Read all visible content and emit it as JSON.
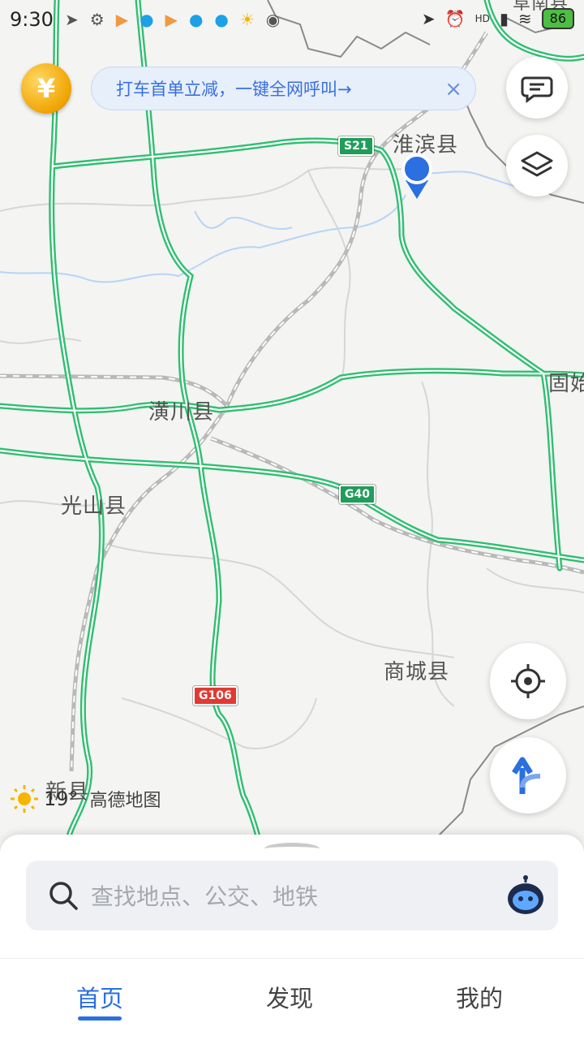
{
  "status_bar": {
    "time": "9:30",
    "battery": "86",
    "network": "HD"
  },
  "promo": {
    "coin_symbol": "¥",
    "banner_text": "打车首单立减，一键全网呼叫→",
    "close_symbol": "×"
  },
  "map": {
    "labels": {
      "huaibin": "淮滨县",
      "huangchuan": "潢川县",
      "guangshan": "光山县",
      "shangcheng": "商城县",
      "xinxian": "新县",
      "gushi_partial": "固始",
      "top_partial": "阜南县"
    },
    "shields": {
      "s21": "S21",
      "g40": "G40",
      "g106": "G106"
    },
    "colors": {
      "road_green": "#2fbf71",
      "national_red": "#e03a32",
      "location_blue": "#2b6fe0",
      "water_blue": "#b8d4f5"
    }
  },
  "weather": {
    "temperature": "19°",
    "brand": "高德地图"
  },
  "buttons": {
    "message": "chat-bubble-icon",
    "layers": "layers-icon",
    "locate": "locate-target-icon",
    "route": "route-arrow-icon"
  },
  "search": {
    "placeholder": "查找地点、公交、地铁"
  },
  "tabs": {
    "home": "首页",
    "discover": "发现",
    "mine": "我的"
  }
}
